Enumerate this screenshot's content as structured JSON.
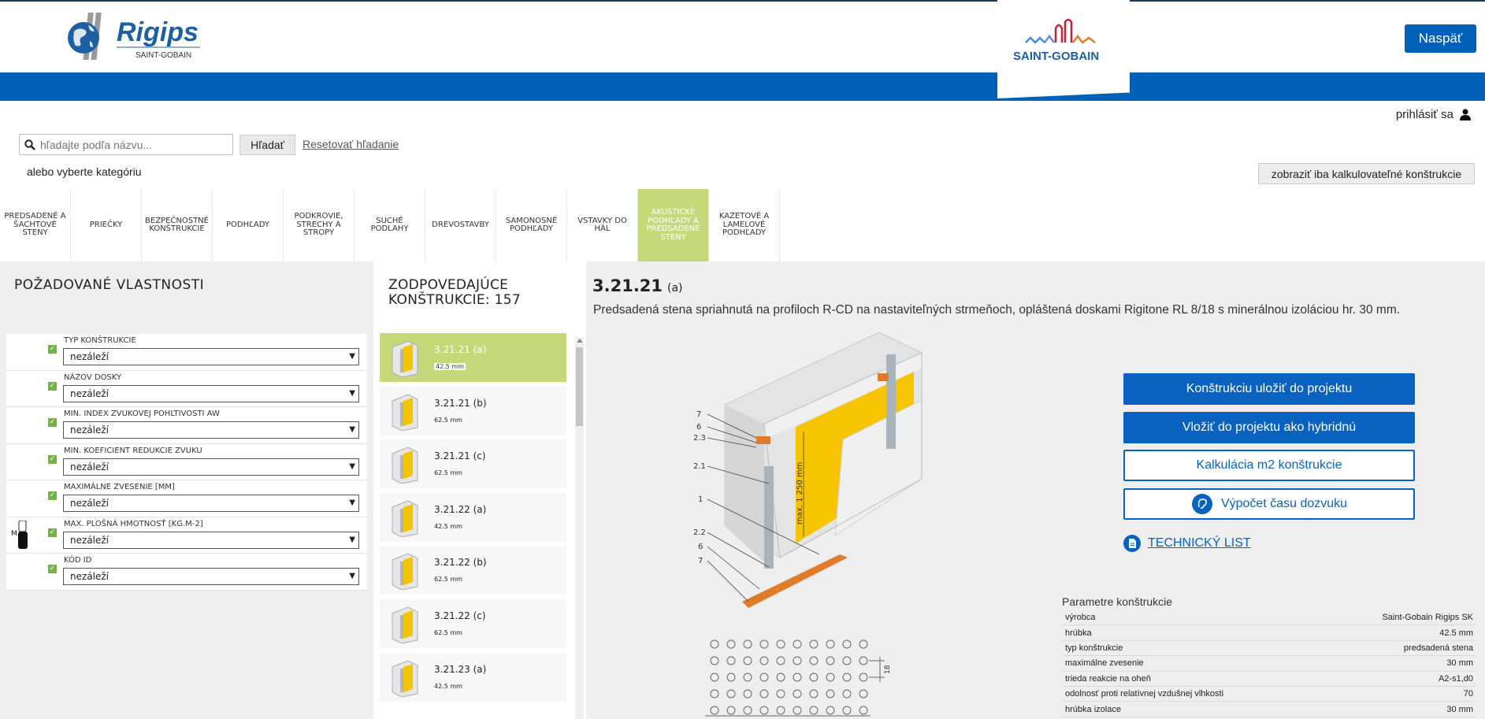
{
  "header": {
    "logo_text": "Rigips",
    "logo_sub": "SAINT-GOBAIN",
    "partner_logo_text": "SAINT-GOBAIN",
    "back_label": "Naspäť",
    "login_label": "prihlásiť sa",
    "brand_color": "#0061b9"
  },
  "search": {
    "placeholder": "hľadajte podľa názvu...",
    "button_label": "Hľadať",
    "reset_label": "Resetovať hľadanie",
    "or_choose": "alebo vyberte kategóriu",
    "calc_only_label": "zobraziť iba kalkulovateľné konštrukcie"
  },
  "categories": [
    {
      "label": "PREDSADENÉ A ŠACHTOVÉ STENY",
      "active": false
    },
    {
      "label": "PRIEČKY",
      "active": false
    },
    {
      "label": "BEZPEČNOSTNÉ KONŠTRUKCIE",
      "active": false
    },
    {
      "label": "PODHĽADY",
      "active": false
    },
    {
      "label": "PODKROVIE, STRECHY A STROPY",
      "active": false
    },
    {
      "label": "SUCHÉ PODLAHY",
      "active": false
    },
    {
      "label": "DREVOSTAVBY",
      "active": false
    },
    {
      "label": "SAMONOSNÉ PODHĽADY",
      "active": false
    },
    {
      "label": "VSTAVKY DO HÁL",
      "active": false
    },
    {
      "label": "AKUSTICKÉ PODHĽADY A PREDSADENÉ STENY",
      "active": true
    },
    {
      "label": "KAZETOVÉ A LAMELOVÉ PODHĽADY",
      "active": false
    }
  ],
  "filters": {
    "title": "POŽADOVANÉ VLASTNOSTI",
    "items": [
      {
        "label": "TYP KONŠTRUKCIE",
        "value": "nezáleží"
      },
      {
        "label": "NÁZOV DOSKY",
        "value": "nezáleží"
      },
      {
        "label": "MIN. INDEX ZVUKOVEJ POHLTIVOSTI Aw",
        "value": "nezáleží"
      },
      {
        "label": "MIN. KOEFICIENT REDUKCIE ZVUKU",
        "value": "nezáleží"
      },
      {
        "label": "MAXIMÁLNE ZVESENIE [mm]",
        "value": "nezáleží"
      },
      {
        "label": "MAX. PLOŠNÁ HMOTNOSŤ [kg.m-2]",
        "value": "nezáleží"
      },
      {
        "label": "KÓD ID",
        "value": "nezáleží"
      }
    ],
    "toggle_label": "M"
  },
  "list": {
    "title_line1": "ZODPOVEDAJÚCE",
    "title_line2": "KONŠTRUKCIE: 157",
    "items": [
      {
        "name": "3.21.21 (a)",
        "thickness": "42.5 mm",
        "selected": true
      },
      {
        "name": "3.21.21 (b)",
        "thickness": "62.5 mm",
        "selected": false
      },
      {
        "name": "3.21.21 (c)",
        "thickness": "62.5 mm",
        "selected": false
      },
      {
        "name": "3.21.22 (a)",
        "thickness": "42.5 mm",
        "selected": false
      },
      {
        "name": "3.21.22 (b)",
        "thickness": "62.5 mm",
        "selected": false
      },
      {
        "name": "3.21.22 (c)",
        "thickness": "62.5 mm",
        "selected": false
      },
      {
        "name": "3.21.23 (a)",
        "thickness": "42.5 mm",
        "selected": false
      }
    ]
  },
  "detail": {
    "code": "3.21.21",
    "variant": "(a)",
    "description": "Predsadená stena spriahnutá na profiloch R-CD na nastaviteľných strmeňoch, opláštená doskami Rigitone RL 8/18 s minerálnou izoláciou hr. 30 mm.",
    "callouts_upper": [
      "7",
      "6",
      "2.3",
      "2.1",
      "1"
    ],
    "callouts_lower": [
      "2.2",
      "6",
      "7"
    ],
    "max_label": "max. 1 250 mm",
    "perf_dim": "18",
    "buttons": {
      "save": "Konštrukciu uložiť do projektu",
      "hybrid": "Vložiť do projektu ako hybridnú",
      "calc": "Kalkulácia m2 konštrukcie",
      "reverb": "Výpočet času dozvuku"
    },
    "tech_sheet": "TECHNICKÝ LIST",
    "params_title": "Parametre konštrukcie",
    "params": [
      {
        "k": "výrobca",
        "v": "Saint-Gobain Rigips SK"
      },
      {
        "k": "hrúbka",
        "v": "42.5 mm"
      },
      {
        "k": "typ konštrukcie",
        "v": "predsadená stena"
      },
      {
        "k": "maximálne zvesenie",
        "v": "30 mm"
      },
      {
        "k": "trieda reakcie na oheň",
        "v": "A2-s1,d0"
      },
      {
        "k": "odolnosť proti relatívnej vzdušnej vlhkosti",
        "v": "70"
      },
      {
        "k": "hrúbka izolace",
        "v": "30 mm"
      }
    ]
  }
}
